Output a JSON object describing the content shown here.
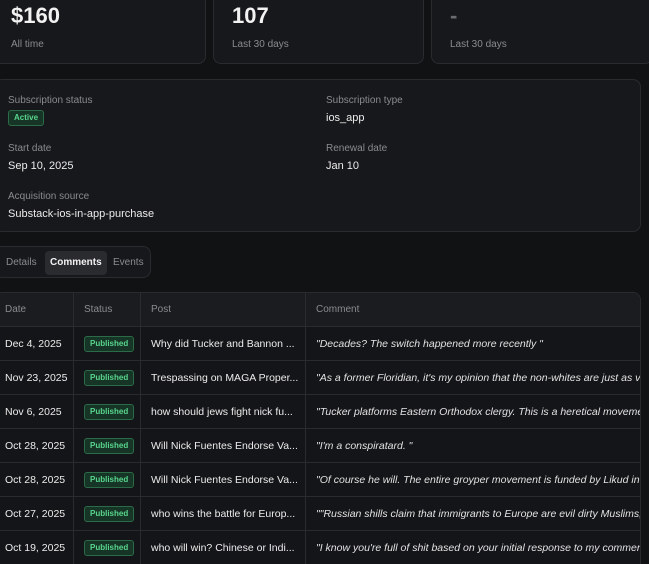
{
  "stats": [
    {
      "value": "$160",
      "label": "All time"
    },
    {
      "value": "107",
      "label": "Last 30 days"
    },
    {
      "value": "-",
      "label": "Last 30 days"
    }
  ],
  "subscription": {
    "status_label": "Subscription status",
    "status_value": "Active",
    "type_label": "Subscription type",
    "type_value": "ios_app",
    "start_label": "Start date",
    "start_value": "Sep 10, 2025",
    "renewal_label": "Renewal date",
    "renewal_value": "Jan 10",
    "source_label": "Acquisition source",
    "source_value": "Substack-ios-in-app-purchase"
  },
  "tabs": [
    {
      "label": "Details"
    },
    {
      "label": "Comments"
    },
    {
      "label": "Events"
    }
  ],
  "table": {
    "headers": [
      "Date",
      "Status",
      "Post",
      "Comment"
    ],
    "rows": [
      {
        "date": "Dec 4, 2025",
        "status": "Published",
        "post": "Why did Tucker and Bannon ...",
        "comment": "\"Decades? The switch happened more recently \""
      },
      {
        "date": "Nov 23, 2025",
        "status": "Published",
        "post": "Trespassing on MAGA Proper...",
        "comment": "\"As a former Floridian, it's my opinion that the non-whites are just as va"
      },
      {
        "date": "Nov 6, 2025",
        "status": "Published",
        "post": "how should jews fight nick fu...",
        "comment": "\"Tucker platforms Eastern Orthodox clergy. This is a heretical movement"
      },
      {
        "date": "Oct 28, 2025",
        "status": "Published",
        "post": "Will Nick Fuentes Endorse Va...",
        "comment": "\"I'm a conspiratard. \""
      },
      {
        "date": "Oct 28, 2025",
        "status": "Published",
        "post": "Will Nick Fuentes Endorse Va...",
        "comment": "\"Of course he will. The entire groyper movement is funded by Likud in o"
      },
      {
        "date": "Oct 27, 2025",
        "status": "Published",
        "post": "who wins the battle for Europ...",
        "comment": "\"\"Russian shills claim that immigrants to Europe are evil dirty Muslims, t"
      },
      {
        "date": "Oct 19, 2025",
        "status": "Published",
        "post": "who will win? Chinese or Indi...",
        "comment": "\"I know you're full of shit based on your initial response to my comment"
      }
    ]
  },
  "colors": {
    "background": "#111214",
    "card": "#17181b",
    "border": "#2a2b2f",
    "badge_green": "#58d68d"
  }
}
